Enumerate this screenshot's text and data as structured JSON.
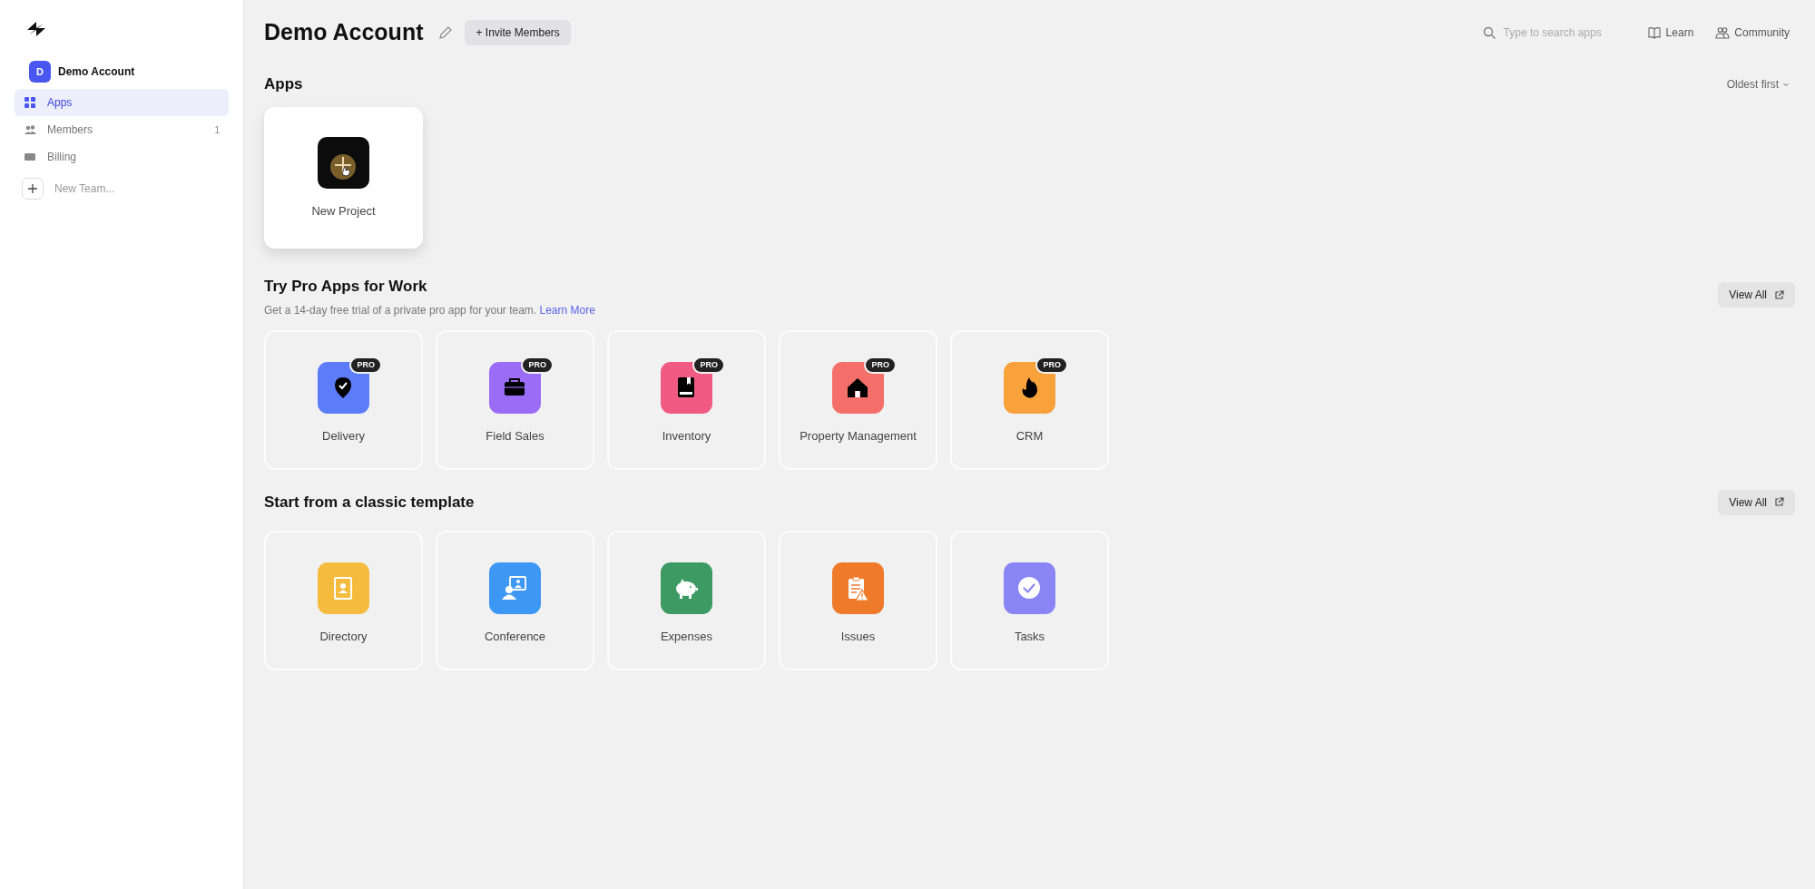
{
  "sidebar": {
    "account": {
      "avatar": "D",
      "name": "Demo Account"
    },
    "items": [
      {
        "label": "Apps",
        "selected": true
      },
      {
        "label": "Members",
        "count": "1",
        "selected": false
      },
      {
        "label": "Billing",
        "selected": false
      }
    ],
    "new_team": "New Team..."
  },
  "header": {
    "title": "Demo Account",
    "invite_button": "+ Invite Members",
    "search": {
      "placeholder": "Type to search apps"
    },
    "links": [
      "Learn",
      "Community"
    ]
  },
  "apps": {
    "title": "Apps",
    "sort": "Oldest first",
    "items": [
      {
        "label": "New Project"
      }
    ]
  },
  "pro": {
    "title": "Try Pro Apps for Work",
    "subtitle": "Get a 14-day free trial of a private pro app for your team.",
    "link": "Learn More",
    "view_all": "View All",
    "items": [
      {
        "label": "Delivery",
        "badge": "PRO"
      },
      {
        "label": "Field Sales",
        "badge": "PRO"
      },
      {
        "label": "Inventory",
        "badge": "PRO"
      },
      {
        "label": "Property Management",
        "badge": "PRO"
      },
      {
        "label": "CRM",
        "badge": "PRO"
      }
    ]
  },
  "templates": {
    "title": "Start from a classic template",
    "view_all": "View All",
    "items": [
      {
        "label": "Directory"
      },
      {
        "label": "Conference"
      },
      {
        "label": "Expenses"
      },
      {
        "label": "Issues"
      },
      {
        "label": "Tasks"
      }
    ]
  }
}
